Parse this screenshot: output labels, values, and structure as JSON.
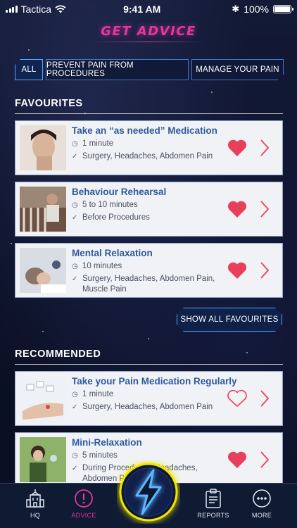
{
  "status_bar": {
    "carrier": "Tactica",
    "time": "9:41 AM",
    "battery": "100%"
  },
  "header": {
    "title": "GET ADVICE"
  },
  "tabs": [
    {
      "label": "ALL",
      "active": true
    },
    {
      "label": "PREVENT PAIN FROM PROCEDURES",
      "active": false
    },
    {
      "label": "MANAGE YOUR PAIN",
      "active": false
    }
  ],
  "favourites": {
    "title": "FAVOURITES",
    "items": [
      {
        "title": "Take an “as needed” Medication",
        "duration": "1 minute",
        "conditions": "Surgery, Headaches, Abdomen Pain",
        "favourite": true
      },
      {
        "title": "Behaviour Rehearsal",
        "duration": "5 to 10 minutes",
        "conditions": "Before Procedures",
        "favourite": true
      },
      {
        "title": "Mental Relaxation",
        "duration": "10 minutes",
        "conditions": "Surgery, Headaches, Abdomen Pain, Muscle Pain",
        "favourite": true
      }
    ],
    "show_all_label": "SHOW ALL FAVOURITES"
  },
  "recommended": {
    "title": "RECOMMENDED",
    "items": [
      {
        "title": "Take your Pain Medication Regularly",
        "duration": "1 minute",
        "conditions": "Surgery, Headaches, Abdomen Pain",
        "favourite": false
      },
      {
        "title": "Mini-Relaxation",
        "duration": "5 minutes",
        "conditions": "During Procedures, Headaches, Abdomen Pain",
        "favourite": true
      }
    ]
  },
  "nav": {
    "hq": "HQ",
    "advice": "ADVICE",
    "reports": "REPORTS",
    "more": "MORE"
  },
  "colors": {
    "accent_pink": "#e8349f",
    "accent_blue": "#54a6ff",
    "card_title": "#2d5a9c",
    "heart": "#e8405c",
    "bolt": "#f2e600"
  }
}
